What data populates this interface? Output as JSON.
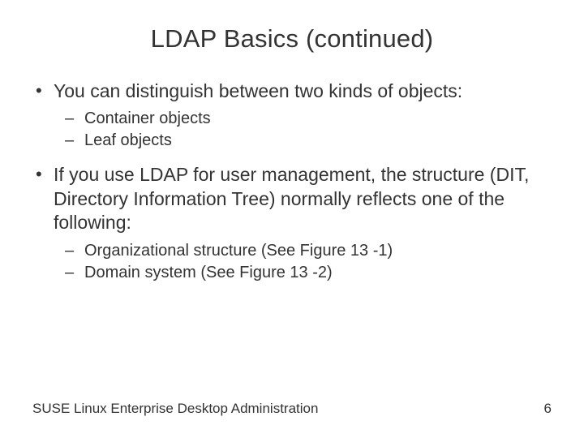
{
  "title": "LDAP Basics (continued)",
  "bullets": [
    {
      "text": "You can distinguish between two kinds of objects:",
      "sub": [
        "Container objects",
        "Leaf objects"
      ]
    },
    {
      "text": "If you use LDAP for user management, the structure (DIT, Directory Information Tree) normally reflects one of the following:",
      "sub": [
        "Organizational structure (See Figure 13 -1)",
        "Domain system (See Figure 13 -2)"
      ]
    }
  ],
  "footer_left": "SUSE Linux Enterprise Desktop Administration",
  "footer_right": "6"
}
